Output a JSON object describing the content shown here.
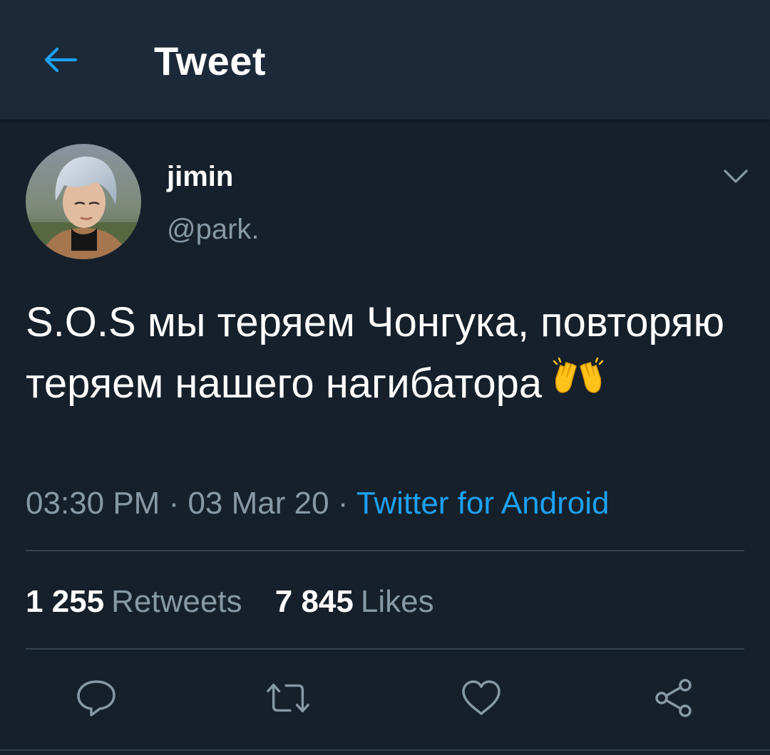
{
  "header": {
    "title": "Tweet",
    "back_icon": "arrow-left-icon",
    "accent_color": "#1da1f2"
  },
  "tweet": {
    "author": {
      "display_name": "jimin",
      "handle": "@park."
    },
    "text": "S.O.S мы теряем Чонгука, повторяю теряем нашего нагибатора",
    "emoji": "raising-hands-emoji",
    "time": "03:30 PM",
    "separator": " · ",
    "date": "03 Mar 20",
    "source": "Twitter for Android",
    "stats": {
      "retweets_count": "1 255",
      "retweets_label": "Retweets",
      "likes_count": "7 845",
      "likes_label": "Likes"
    },
    "actions": [
      "reply-icon",
      "retweet-icon",
      "like-icon",
      "share-icon"
    ],
    "caret_icon": "chevron-down-icon"
  },
  "colors": {
    "background": "#15202b",
    "header_background": "#1c2938",
    "secondary_text": "#8899a6",
    "divider": "#38444d",
    "link": "#1da1f2"
  }
}
